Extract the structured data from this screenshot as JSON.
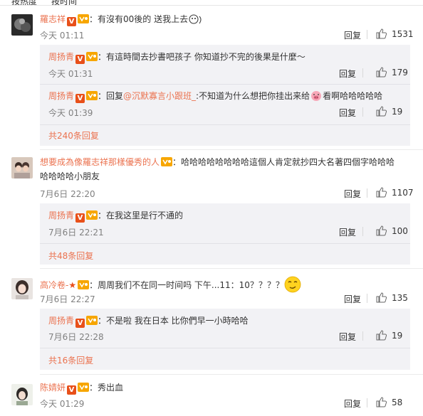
{
  "tabs": {
    "hot": "按热度",
    "time": "按时间"
  },
  "reply_label": "回复",
  "comments": [
    {
      "user": "羅志祥",
      "text": "：有沒有00後的 送我上去",
      "time": "今天 01:11",
      "likes": "1531",
      "replies": [
        {
          "user": "周扬青",
          "text": "：有這時間去抄書吧孩子 你知道抄不完的後果是什麼～",
          "time": "今天 01:31",
          "likes": "179"
        },
        {
          "user": "周扬青",
          "text_prefix": "：回复",
          "mention": "@沉默寡言小跟班_",
          "text": ":不知道为什么想把你挂出来给",
          "text_suffix": "看啊哈哈哈哈哈",
          "time": "今天 01:39",
          "likes": "19"
        }
      ],
      "more": "共240条回复"
    },
    {
      "user": "想要成為像羅志祥那樣優秀的人",
      "text": "：哈哈哈哈哈哈哈哈這個人肯定就抄四大名著四個字哈哈哈",
      "text_line2": "哈哈哈哈小朋友",
      "time": "7月6日 22:20",
      "likes": "1107",
      "replies": [
        {
          "user": "周扬青",
          "text": "：在我这里是行不通的",
          "time": "7月6日 22:21",
          "likes": "100"
        }
      ],
      "more": "共48条回复"
    },
    {
      "user": "高冷卷-",
      "text": "：周周我们不在同一时间吗 下午...11：10？？？？",
      "time": "7月6日 22:27",
      "likes": "135",
      "replies": [
        {
          "user": "周扬青",
          "text": "：不是啦 我在日本 比你們早一小時哈哈",
          "time": "7月6日 22:28",
          "likes": "19"
        }
      ],
      "more": "共16条回复"
    },
    {
      "user": "陈婧妍",
      "text": "：秀出血",
      "time": "今天 01:29",
      "likes": "58"
    }
  ],
  "colors": {
    "accent": "#eb7350",
    "subbox": "#f2f2f5",
    "badge": "#e8501a"
  }
}
